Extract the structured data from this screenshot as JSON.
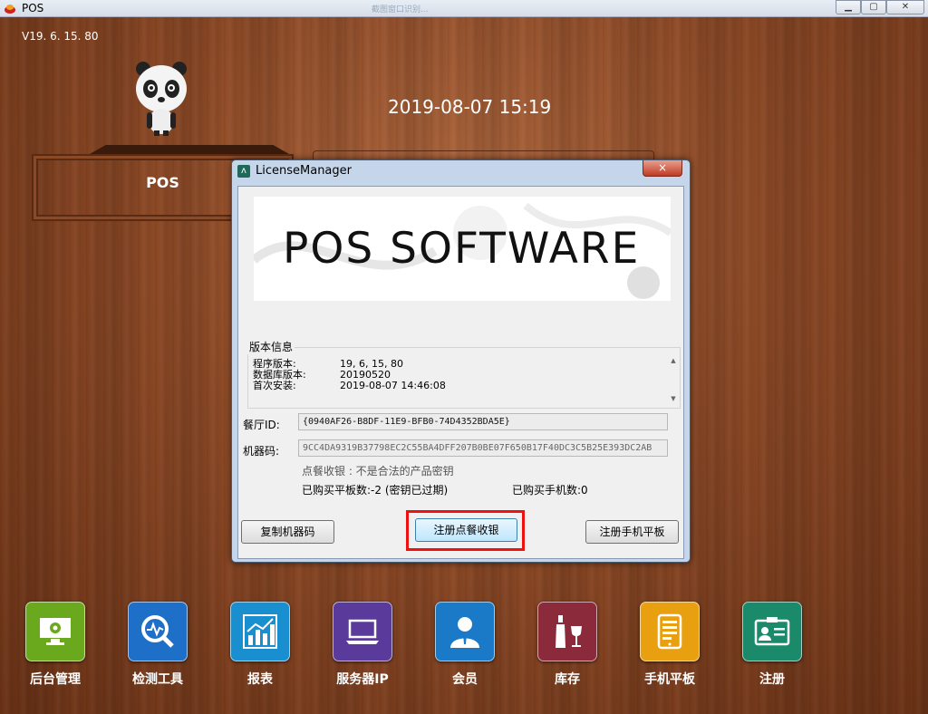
{
  "window": {
    "title": "POS",
    "faint_text": "截图窗口识别..."
  },
  "top": {
    "version": "V19. 6. 15. 80",
    "datetime": "2019-08-07 15:19",
    "pos_label": "POS"
  },
  "dialog": {
    "title": "LicenseManager",
    "close_label": "×",
    "banner_text": "POS SOFTWARE",
    "group_title": "版本信息",
    "rows": [
      {
        "k": "程序版本:",
        "v": "19, 6, 15, 80"
      },
      {
        "k": "数据库版本:",
        "v": "20190520"
      },
      {
        "k": "首次安装:",
        "v": "2019-08-07 14:46:08"
      }
    ],
    "restaurant_id_label": "餐厅ID:",
    "restaurant_id": "{0940AF26-B8DF-11E9-BFB0-74D4352BDA5E}",
    "machine_code_label": "机器码:",
    "machine_code": "9CC4DA9319B37798EC2C55BA4DFF207B0BE07F650B17F40DC3C5B25E393DC2AB",
    "status": "点餐收银 : 不是合法的产品密钥",
    "tablet_count": "已购买平板数:-2 (密钥已过期)",
    "phone_count": "已购买手机数:0",
    "buttons": {
      "copy": "复制机器码",
      "register_pos": "注册点餐收银",
      "register_mobile": "注册手机平板"
    }
  },
  "dock": [
    {
      "label": "后台管理",
      "color": "#6aa81e",
      "icon": "monitor-gear-icon"
    },
    {
      "label": "检测工具",
      "color": "#1e6fc8",
      "icon": "magnifier-pulse-icon"
    },
    {
      "label": "报表",
      "color": "#1a8fd0",
      "icon": "bar-chart-icon"
    },
    {
      "label": "服务器IP",
      "color": "#5a3a9a",
      "icon": "laptop-icon"
    },
    {
      "label": "会员",
      "color": "#1a7ac8",
      "icon": "user-icon"
    },
    {
      "label": "库存",
      "color": "#8a2a3a",
      "icon": "wine-icon"
    },
    {
      "label": "手机平板",
      "color": "#e8a010",
      "icon": "tablet-icon"
    },
    {
      "label": "注册",
      "color": "#1a8a6a",
      "icon": "id-card-icon"
    }
  ]
}
